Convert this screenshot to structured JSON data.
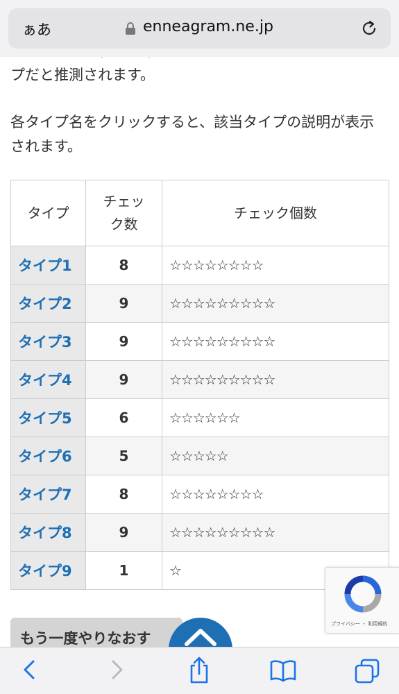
{
  "browser": {
    "text_size_label": "ぁあ",
    "url": "enneagram.ne.jp"
  },
  "content": {
    "para1": "タツ有りた数(黄の数)がタいタイプが、あなたの性格タイプだと推測されます。",
    "para2": "各タイプ名をクリックすると、該当タイプの説明が表示されます。",
    "table": {
      "headers": [
        "タイプ",
        "チェック数",
        "チェック個数"
      ],
      "rows": [
        {
          "type": "タイプ1",
          "count": "8",
          "stars": "☆☆☆☆☆☆☆☆"
        },
        {
          "type": "タイプ2",
          "count": "9",
          "stars": "☆☆☆☆☆☆☆☆☆"
        },
        {
          "type": "タイプ3",
          "count": "9",
          "stars": "☆☆☆☆☆☆☆☆☆"
        },
        {
          "type": "タイプ4",
          "count": "9",
          "stars": "☆☆☆☆☆☆☆☆☆"
        },
        {
          "type": "タイプ5",
          "count": "6",
          "stars": "☆☆☆☆☆☆"
        },
        {
          "type": "タイプ6",
          "count": "5",
          "stars": "☆☆☆☆☆"
        },
        {
          "type": "タイプ7",
          "count": "8",
          "stars": "☆☆☆☆☆☆☆☆"
        },
        {
          "type": "タイプ8",
          "count": "9",
          "stars": "☆☆☆☆☆☆☆☆☆"
        },
        {
          "type": "タイプ9",
          "count": "1",
          "stars": "☆"
        }
      ]
    },
    "retry_label": "もう一度やりなおす",
    "recaptcha_text": "プライバシー ・ 利用規約"
  },
  "toolbar": {
    "icons": [
      "back-icon",
      "forward-icon",
      "share-icon",
      "bookmarks-icon",
      "tabs-icon"
    ]
  },
  "colors": {
    "link": "#1f6fb5",
    "type_cell_bg": "#e9e9e9",
    "scroll_button": "#1f6fb5"
  }
}
